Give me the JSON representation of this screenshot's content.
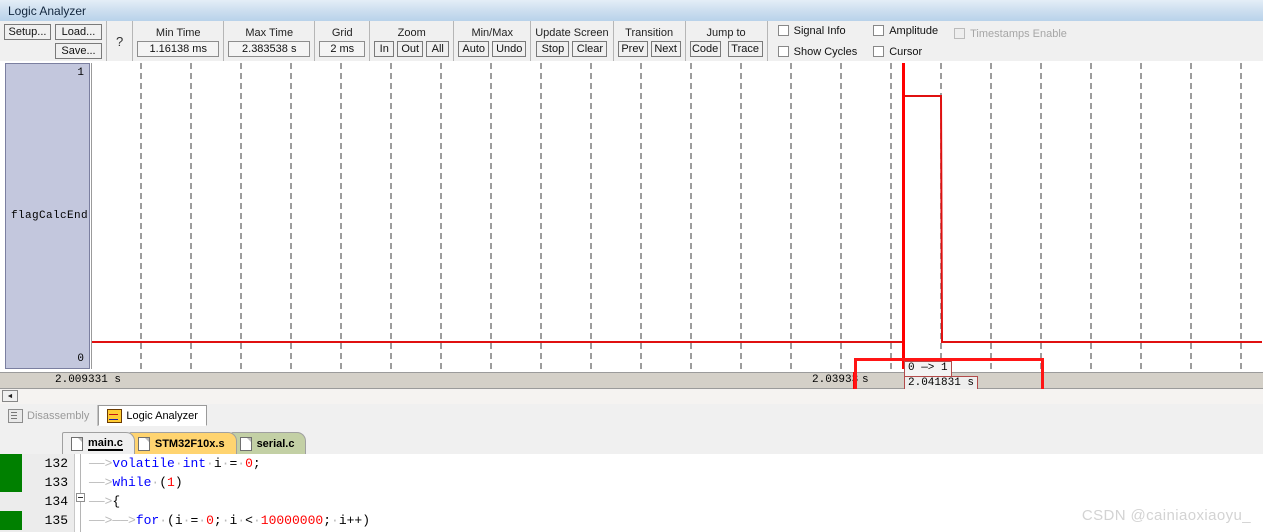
{
  "window": {
    "title": "Logic Analyzer"
  },
  "toolbar": {
    "setup_label": "Setup...",
    "load_label": "Load...",
    "save_label": "Save...",
    "help_label": "?",
    "min_time": {
      "caption": "Min Time",
      "value": "1.16138 ms"
    },
    "max_time": {
      "caption": "Max Time",
      "value": "2.383538 s"
    },
    "grid": {
      "caption": "Grid",
      "value": "2 ms"
    },
    "zoom": {
      "caption": "Zoom",
      "in": "In",
      "out": "Out",
      "all": "All"
    },
    "minmax": {
      "caption": "Min/Max",
      "auto": "Auto",
      "undo": "Undo"
    },
    "update_screen": {
      "caption": "Update Screen",
      "stop": "Stop",
      "clear": "Clear"
    },
    "transition": {
      "caption": "Transition",
      "prev": "Prev",
      "next": "Next"
    },
    "jump_to": {
      "caption": "Jump to",
      "code": "Code",
      "trace": "Trace"
    },
    "checkboxes": [
      {
        "label": "Signal Info",
        "checked": false,
        "disabled": false
      },
      {
        "label": "Show Cycles",
        "checked": false,
        "disabled": false
      },
      {
        "label": "Amplitude",
        "checked": false,
        "disabled": false
      },
      {
        "label": "Cursor",
        "checked": false,
        "disabled": false
      },
      {
        "label": "Timestamps Enable",
        "checked": false,
        "disabled": true
      }
    ]
  },
  "signal": {
    "name": "flagCalcEnd",
    "high_label": "1",
    "low_label": "0"
  },
  "ruler": {
    "left_time": "2.009331 s",
    "right_time": "2.03933",
    "unit": "s"
  },
  "annotation": {
    "transition": "0 —> 1",
    "timestamp": "2.041831 s"
  },
  "scrollbar": {
    "left_arrow": "◄"
  },
  "view_tabs": [
    {
      "label": "Disassembly",
      "icon": "disassembly-icon",
      "active": false
    },
    {
      "label": "Logic Analyzer",
      "icon": "logic-analyzer-icon",
      "active": true
    }
  ],
  "file_tabs": [
    {
      "label": "main.c",
      "icon": "file-icon",
      "active": true
    },
    {
      "label": "STM32F10x.s",
      "icon": "file-icon",
      "active": false
    },
    {
      "label": "serial.c",
      "icon": "file-icon",
      "active": false
    }
  ],
  "editor": {
    "lines": [
      {
        "num": "132",
        "marked": true
      },
      {
        "num": "133",
        "marked": true
      },
      {
        "num": "134",
        "marked": false
      },
      {
        "num": "135",
        "marked": true
      }
    ]
  },
  "colors": {
    "accent_red": "#ff0000",
    "signal_trace": "#e01010",
    "signal_panel": "#c3c7dd",
    "keyword_blue": "#0000ff",
    "number_red": "#ff0000"
  },
  "watermark": "CSDN @cainiaoxiaoyu_"
}
